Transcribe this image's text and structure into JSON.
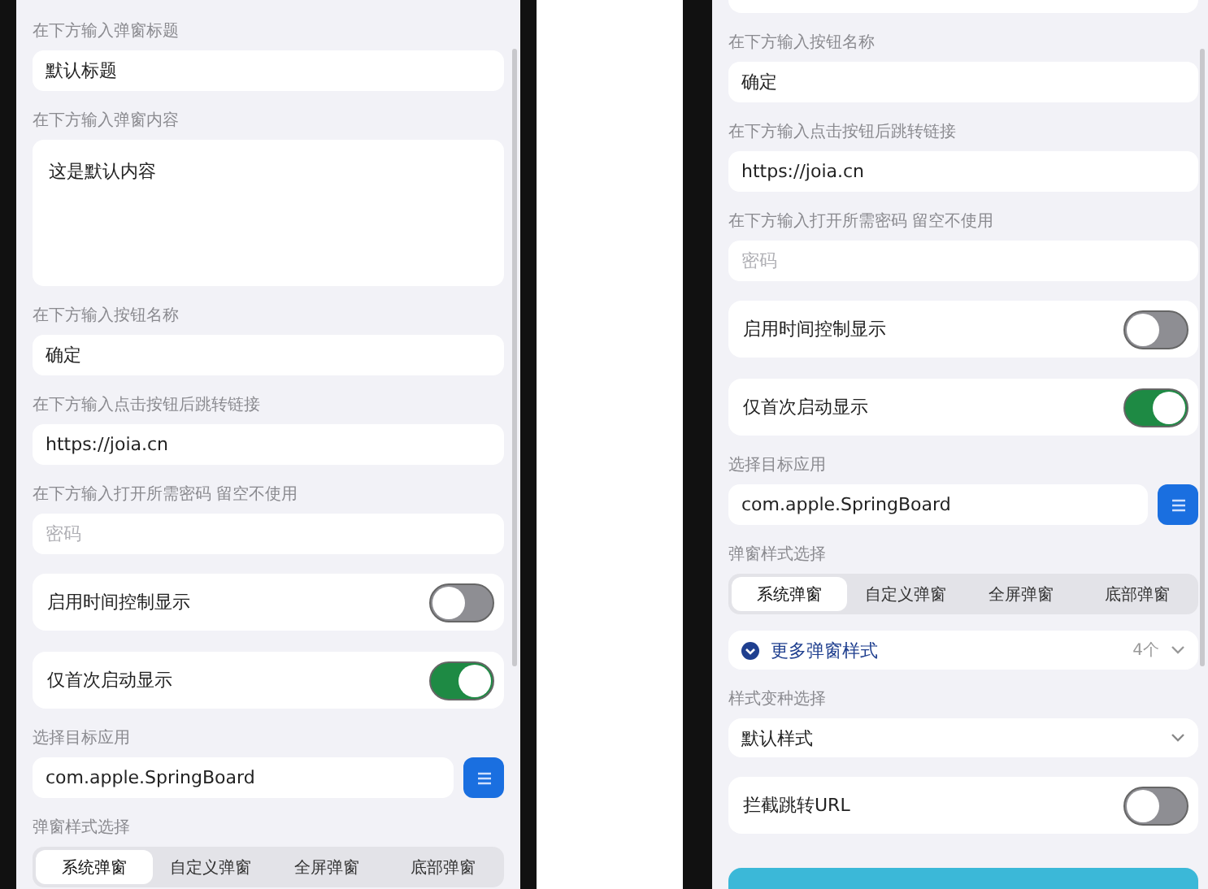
{
  "phones": [
    {
      "items": [
        {
          "kind": "label",
          "text": "在下方输入弹窗标题"
        },
        {
          "kind": "field",
          "value": "默认标题"
        },
        {
          "kind": "label",
          "text": "在下方输入弹窗内容"
        },
        {
          "kind": "textarea",
          "value": "这是默认内容"
        },
        {
          "kind": "label",
          "text": "在下方输入按钮名称"
        },
        {
          "kind": "field",
          "value": "确定"
        },
        {
          "kind": "label",
          "text": "在下方输入点击按钮后跳转链接"
        },
        {
          "kind": "field",
          "value": "https://joia.cn"
        },
        {
          "kind": "label",
          "text": "在下方输入打开所需密码 留空不使用"
        },
        {
          "kind": "field",
          "placeholder": "密码"
        },
        {
          "kind": "toggle",
          "text": "启用时间控制显示",
          "on": false
        },
        {
          "kind": "toggle",
          "text": "仅首次启动显示",
          "on": true
        },
        {
          "kind": "label",
          "text": "选择目标应用"
        },
        {
          "kind": "picker",
          "value": "com.apple.SpringBoard"
        },
        {
          "kind": "label",
          "text": "弹窗样式选择"
        },
        {
          "kind": "segmented",
          "options": [
            {
              "label": "系统弹窗",
              "selected": true
            },
            {
              "label": "自定义弹窗",
              "selected": false
            },
            {
              "label": "全屏弹窗",
              "selected": false
            },
            {
              "label": "底部弹窗",
              "selected": false
            }
          ]
        },
        {
          "kind": "blank"
        }
      ]
    },
    {
      "items": [
        {
          "kind": "blank"
        },
        {
          "kind": "label",
          "text": "在下方输入按钮名称"
        },
        {
          "kind": "field",
          "value": "确定"
        },
        {
          "kind": "label",
          "text": "在下方输入点击按钮后跳转链接"
        },
        {
          "kind": "field",
          "value": "https://joia.cn"
        },
        {
          "kind": "label",
          "text": "在下方输入打开所需密码 留空不使用"
        },
        {
          "kind": "field",
          "placeholder": "密码"
        },
        {
          "kind": "toggle",
          "text": "启用时间控制显示",
          "on": false
        },
        {
          "kind": "toggle",
          "text": "仅首次启动显示",
          "on": true
        },
        {
          "kind": "label",
          "text": "选择目标应用"
        },
        {
          "kind": "picker",
          "value": "com.apple.SpringBoard"
        },
        {
          "kind": "label",
          "text": "弹窗样式选择"
        },
        {
          "kind": "segmented",
          "options": [
            {
              "label": "系统弹窗",
              "selected": true
            },
            {
              "label": "自定义弹窗",
              "selected": false
            },
            {
              "label": "全屏弹窗",
              "selected": false
            },
            {
              "label": "底部弹窗",
              "selected": false
            }
          ]
        },
        {
          "kind": "disclosure",
          "text": "更多弹窗样式",
          "count": "4个"
        },
        {
          "kind": "label",
          "text": "样式变种选择"
        },
        {
          "kind": "select",
          "value": "默认样式"
        },
        {
          "kind": "toggle",
          "text": "拦截跳转URL",
          "on": false
        },
        {
          "kind": "action"
        }
      ]
    }
  ]
}
